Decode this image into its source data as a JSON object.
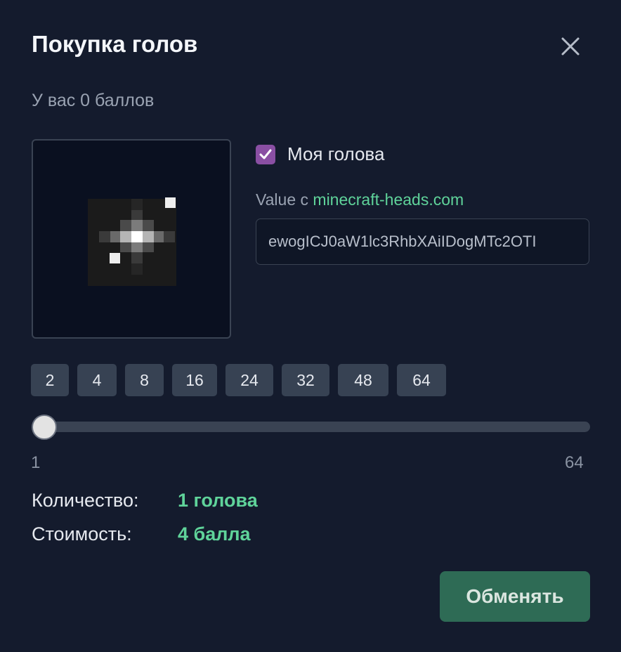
{
  "dialog": {
    "title": "Покупка голов",
    "balance_text": "У вас 0 баллов",
    "close_icon": "close-icon"
  },
  "preview": {
    "icon": "minecraft-head-preview-icon"
  },
  "my_head": {
    "checked": true,
    "label": "Моя голова"
  },
  "value_field": {
    "label_prefix": "Value с ",
    "link_text": "minecraft-heads.com",
    "value": "ewogICJ0aW1lc3RhbXAiIDogMTc2OTI"
  },
  "presets": [
    "2",
    "4",
    "8",
    "16",
    "24",
    "32",
    "48",
    "64"
  ],
  "slider": {
    "min_label": "1",
    "max_label": "64",
    "value": 1
  },
  "quantity": {
    "label": "Количество:",
    "value": "1 голова"
  },
  "cost": {
    "label": "Стоимость:",
    "value": "4 балла"
  },
  "submit_label": "Обменять",
  "colors": {
    "background": "#141b2d",
    "accent_green": "#5fd39a",
    "checkbox_purple": "#8a4fa3",
    "button_green": "#2e6b55"
  }
}
